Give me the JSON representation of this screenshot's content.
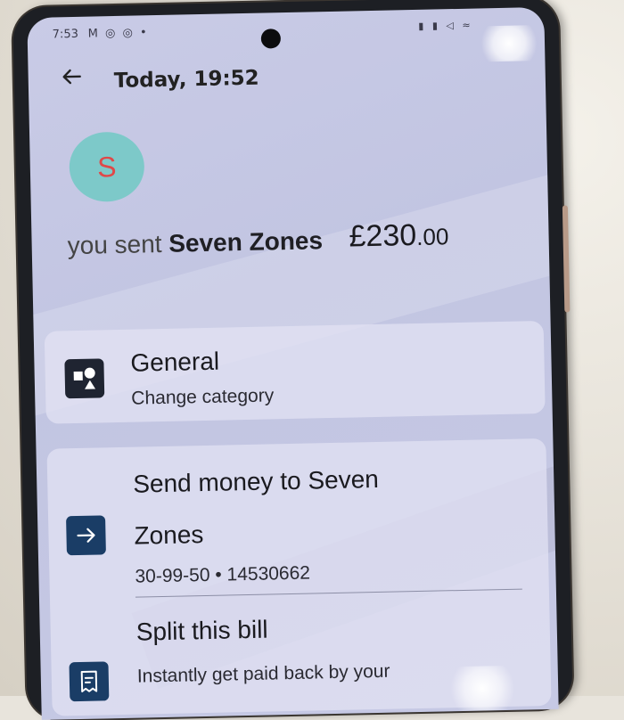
{
  "status_bar": {
    "time": "7:53",
    "notification_icons": "M ◎ ◎ •",
    "system_icons": "▮ ▮ ◁ ≈"
  },
  "header": {
    "title": "Today, 19:52",
    "back_icon": "arrow-left-icon"
  },
  "transaction": {
    "avatar_letter": "S",
    "avatar_color": "#7dc9c9",
    "prefix": "you sent",
    "payee": "Seven Zones",
    "amount_major": "£230",
    "amount_minor": ".00"
  },
  "category": {
    "title": "General",
    "subtitle": "Change category",
    "icon": "shapes-icon"
  },
  "send_money": {
    "title_line1": "Send money to Seven",
    "title_line2": "Zones",
    "account": "30-99-50 • 14530662",
    "icon": "arrow-right-icon"
  },
  "split_bill": {
    "title": "Split this bill",
    "subtitle": "Instantly get paid back by your",
    "icon": "receipt-icon"
  },
  "colors": {
    "icon_dark": "#1f2431",
    "icon_blue": "#1a3d66"
  }
}
